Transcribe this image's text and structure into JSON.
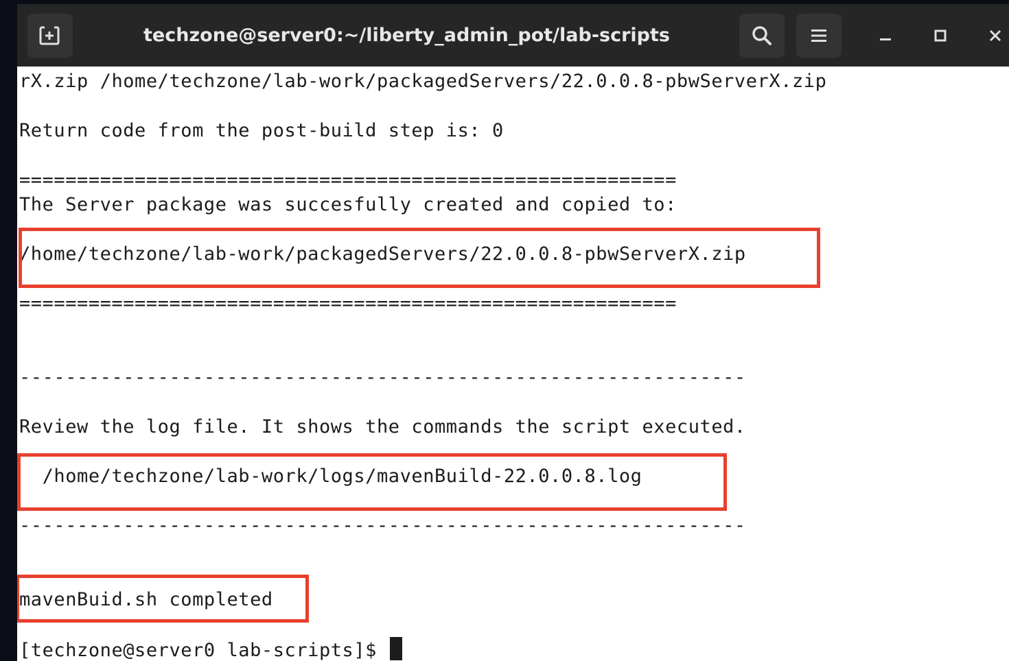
{
  "window": {
    "title": "techzone@server0:~/liberty_admin_pot/lab-scripts",
    "buttons": [
      "new-tab",
      "search",
      "menu",
      "minimize",
      "maximize",
      "close"
    ]
  },
  "terminal": {
    "lines": {
      "l1": "rX.zip /home/techzone/lab-work/packagedServers/22.0.0.8-pbwServerX.zip",
      "l2": "Return code from the post-build step is: 0",
      "sep_eq1": "=========================================================",
      "l3": "The Server package was succesfully created and copied to:",
      "l4": "/home/techzone/lab-work/packagedServers/22.0.0.8-pbwServerX.zip",
      "sep_eq2": "=========================================================",
      "sep_dash1": "---------------------------------------------------------------",
      "l5": "Review the log file. It shows the commands the script executed.",
      "l6": "  /home/techzone/lab-work/logs/mavenBuild-22.0.0.8.log",
      "sep_dash2": "---------------------------------------------------------------",
      "l7": "mavenBuid.sh completed",
      "prompt": "[techzone@server0 lab-scripts]$ "
    }
  },
  "colors": {
    "titlebar": "#262626",
    "terminal_bg": "#ffffff",
    "text": "#1c1c1c",
    "highlight": "#e8402e"
  }
}
